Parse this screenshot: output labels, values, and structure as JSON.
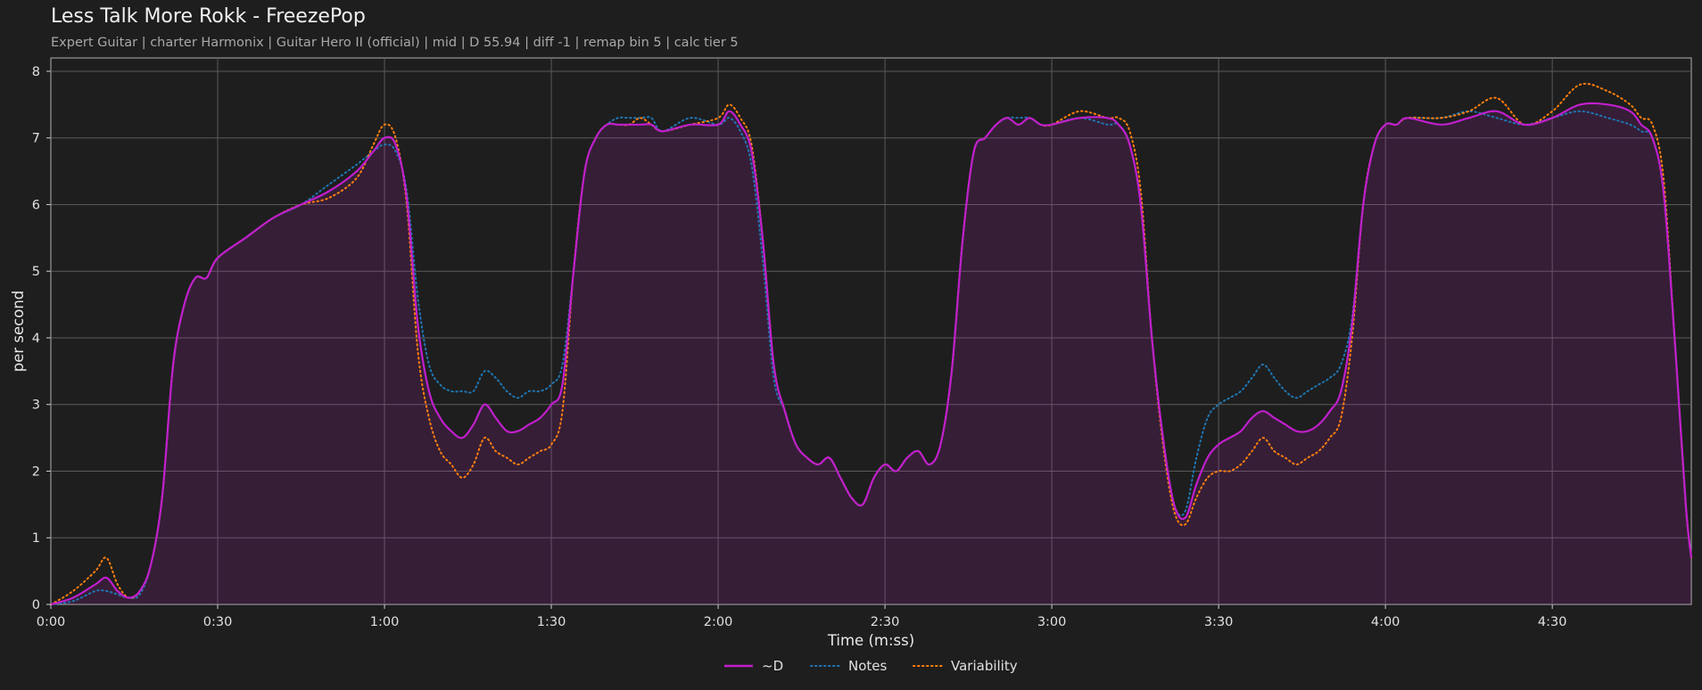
{
  "chart_data": {
    "type": "line",
    "title": "Less Talk More Rokk - FreezePop",
    "subtitle": "Expert Guitar  |  charter Harmonix  |  Guitar Hero II (official)  |  mid  |  D 55.94  |  diff -1  |  remap bin 5  |  calc tier 5",
    "xlabel": "Time (m:ss)",
    "ylabel": "per second",
    "xlim": [
      0,
      295
    ],
    "ylim": [
      0,
      8.2
    ],
    "x_ticks": [
      {
        "value": 0,
        "label": "0:00"
      },
      {
        "value": 30,
        "label": "0:30"
      },
      {
        "value": 60,
        "label": "1:00"
      },
      {
        "value": 90,
        "label": "1:30"
      },
      {
        "value": 120,
        "label": "2:00"
      },
      {
        "value": 150,
        "label": "2:30"
      },
      {
        "value": 180,
        "label": "3:00"
      },
      {
        "value": 210,
        "label": "3:30"
      },
      {
        "value": 240,
        "label": "4:00"
      },
      {
        "value": 270,
        "label": "4:30"
      }
    ],
    "y_ticks": [
      0,
      1,
      2,
      3,
      4,
      5,
      6,
      7,
      8
    ],
    "grid": true,
    "legend_position": "bottom-center",
    "x": [
      0,
      4,
      8,
      10,
      12,
      14,
      16,
      18,
      20,
      22,
      24,
      26,
      28,
      30,
      35,
      40,
      45,
      50,
      55,
      58,
      60,
      62,
      64,
      66,
      68,
      70,
      72,
      74,
      76,
      78,
      80,
      82,
      84,
      86,
      88,
      90,
      92,
      94,
      96,
      98,
      100,
      102,
      104,
      106,
      108,
      110,
      115,
      120,
      122,
      124,
      126,
      128,
      130,
      132,
      134,
      136,
      138,
      140,
      142,
      144,
      146,
      148,
      150,
      152,
      154,
      156,
      158,
      160,
      162,
      164,
      166,
      168,
      170,
      172,
      174,
      176,
      178,
      180,
      185,
      190,
      192,
      194,
      196,
      198,
      200,
      202,
      204,
      206,
      208,
      210,
      212,
      214,
      216,
      218,
      220,
      222,
      224,
      226,
      228,
      230,
      232,
      234,
      236,
      238,
      240,
      242,
      244,
      250,
      255,
      260,
      265,
      270,
      275,
      280,
      284,
      286,
      288,
      290,
      292,
      294,
      295
    ],
    "series": [
      {
        "name": "~D",
        "color": "#c01fcc",
        "style": "solid",
        "values": [
          0.0,
          0.1,
          0.3,
          0.4,
          0.2,
          0.1,
          0.2,
          0.6,
          1.6,
          3.6,
          4.5,
          4.9,
          4.9,
          5.2,
          5.5,
          5.8,
          6.0,
          6.2,
          6.5,
          6.8,
          7.0,
          6.9,
          6.1,
          4.2,
          3.2,
          2.8,
          2.6,
          2.5,
          2.7,
          3.0,
          2.8,
          2.6,
          2.6,
          2.7,
          2.8,
          3.0,
          3.3,
          5.0,
          6.5,
          7.0,
          7.2,
          7.2,
          7.2,
          7.2,
          7.2,
          7.1,
          7.2,
          7.2,
          7.4,
          7.2,
          6.8,
          5.5,
          3.6,
          2.9,
          2.4,
          2.2,
          2.1,
          2.2,
          1.9,
          1.6,
          1.5,
          1.9,
          2.1,
          2.0,
          2.2,
          2.3,
          2.1,
          2.4,
          3.5,
          5.5,
          6.8,
          7.0,
          7.2,
          7.3,
          7.2,
          7.3,
          7.2,
          7.2,
          7.3,
          7.3,
          7.2,
          6.9,
          6.0,
          4.0,
          2.5,
          1.5,
          1.3,
          1.8,
          2.2,
          2.4,
          2.5,
          2.6,
          2.8,
          2.9,
          2.8,
          2.7,
          2.6,
          2.6,
          2.7,
          2.9,
          3.2,
          4.2,
          6.0,
          6.9,
          7.2,
          7.2,
          7.3,
          7.2,
          7.3,
          7.4,
          7.2,
          7.3,
          7.5,
          7.5,
          7.4,
          7.2,
          7.0,
          6.2,
          4.0,
          1.5,
          0.7
        ]
      },
      {
        "name": "Notes",
        "color": "#1f77b4",
        "style": "dotted",
        "values": [
          0.0,
          0.05,
          0.2,
          0.2,
          0.15,
          0.1,
          0.15,
          0.6,
          1.6,
          3.6,
          4.5,
          4.9,
          4.9,
          5.2,
          5.5,
          5.8,
          6.0,
          6.3,
          6.6,
          6.8,
          6.9,
          6.8,
          6.2,
          4.6,
          3.6,
          3.3,
          3.2,
          3.2,
          3.2,
          3.5,
          3.4,
          3.2,
          3.1,
          3.2,
          3.2,
          3.3,
          3.6,
          5.0,
          6.5,
          7.0,
          7.2,
          7.3,
          7.3,
          7.3,
          7.3,
          7.1,
          7.3,
          7.2,
          7.3,
          7.1,
          6.6,
          5.2,
          3.4,
          2.9,
          2.4,
          2.2,
          2.1,
          2.2,
          1.9,
          1.6,
          1.5,
          1.9,
          2.1,
          2.0,
          2.2,
          2.3,
          2.1,
          2.4,
          3.5,
          5.5,
          6.8,
          7.0,
          7.2,
          7.3,
          7.3,
          7.3,
          7.2,
          7.2,
          7.3,
          7.2,
          7.2,
          6.9,
          6.0,
          4.0,
          2.5,
          1.5,
          1.4,
          2.2,
          2.8,
          3.0,
          3.1,
          3.2,
          3.4,
          3.6,
          3.4,
          3.2,
          3.1,
          3.2,
          3.3,
          3.4,
          3.6,
          4.3,
          6.0,
          6.9,
          7.2,
          7.2,
          7.3,
          7.3,
          7.4,
          7.3,
          7.2,
          7.3,
          7.4,
          7.3,
          7.2,
          7.1,
          7.0,
          6.2,
          4.0,
          1.5,
          0.7
        ]
      },
      {
        "name": "Variability",
        "color": "#ff7f0e",
        "style": "dotted",
        "values": [
          0.0,
          0.2,
          0.5,
          0.7,
          0.3,
          0.1,
          0.2,
          0.6,
          1.6,
          3.6,
          4.5,
          4.9,
          4.9,
          5.2,
          5.5,
          5.8,
          6.0,
          6.1,
          6.4,
          6.9,
          7.2,
          7.0,
          6.0,
          3.8,
          2.8,
          2.3,
          2.1,
          1.9,
          2.1,
          2.5,
          2.3,
          2.2,
          2.1,
          2.2,
          2.3,
          2.4,
          2.9,
          5.0,
          6.5,
          7.0,
          7.2,
          7.2,
          7.2,
          7.3,
          7.2,
          7.1,
          7.2,
          7.3,
          7.5,
          7.3,
          6.9,
          5.5,
          3.6,
          2.9,
          2.4,
          2.2,
          2.1,
          2.2,
          1.9,
          1.6,
          1.5,
          1.9,
          2.1,
          2.0,
          2.2,
          2.3,
          2.1,
          2.4,
          3.5,
          5.5,
          6.8,
          7.0,
          7.2,
          7.3,
          7.2,
          7.3,
          7.2,
          7.2,
          7.4,
          7.3,
          7.3,
          7.1,
          6.2,
          4.0,
          2.4,
          1.4,
          1.2,
          1.6,
          1.9,
          2.0,
          2.0,
          2.1,
          2.3,
          2.5,
          2.3,
          2.2,
          2.1,
          2.2,
          2.3,
          2.5,
          2.8,
          4.0,
          6.0,
          6.9,
          7.2,
          7.2,
          7.3,
          7.3,
          7.4,
          7.6,
          7.2,
          7.4,
          7.8,
          7.7,
          7.5,
          7.3,
          7.2,
          6.4,
          4.0,
          1.5,
          0.7
        ]
      }
    ]
  }
}
